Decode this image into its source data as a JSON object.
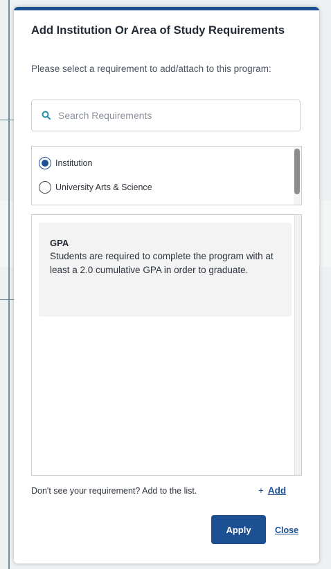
{
  "dialog": {
    "title": "Add Institution Or Area of Study Requirements",
    "subtitle": "Please select a requirement to add/attach to this program:",
    "search": {
      "placeholder": "Search Requirements",
      "value": ""
    },
    "requirement_types": [
      {
        "label": "Institution",
        "selected": true
      },
      {
        "label": "University Arts & Science",
        "selected": false
      }
    ],
    "requirements": [
      {
        "title": "GPA",
        "description": "Students are required to complete the program with at least a 2.0 cumulative GPA in order to graduate."
      }
    ],
    "footer": {
      "missing_text": "Don't see your requirement? Add to the list.",
      "add_plus": "+",
      "add_label": "Add",
      "apply_label": "Apply",
      "close_label": "Close"
    }
  },
  "colors": {
    "accent": "#1d4f93",
    "card_background": "#f3f3f4",
    "border": "#c8ccd1"
  }
}
